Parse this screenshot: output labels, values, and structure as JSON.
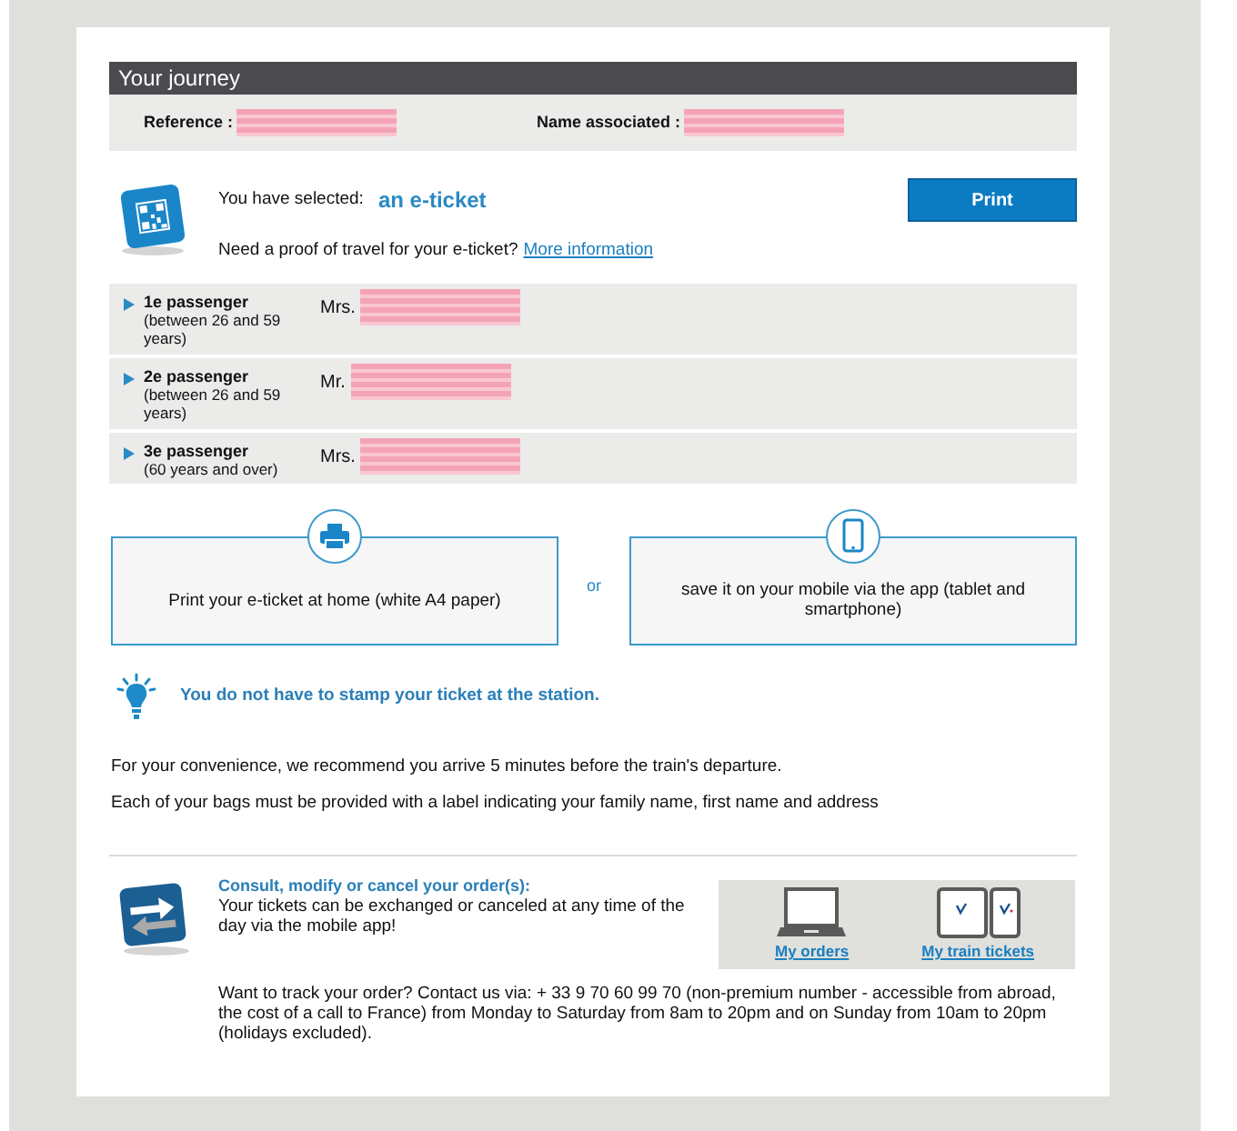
{
  "header": {
    "title": "Your journey"
  },
  "reference_row": [
    {
      "label": "Reference :",
      "redacted": true
    },
    {
      "label": "Name associated :",
      "redacted": true
    }
  ],
  "e_ticket": {
    "intro": "You have selected:",
    "choice": "an e-ticket",
    "print_button": "Print",
    "proof_question": "Need a proof of travel for your e-ticket?",
    "proof_link": "More information"
  },
  "passengers": [
    {
      "label": "1e passenger",
      "age_range": "(between 26 and 59 years)",
      "title": "Mrs.",
      "redacted": true
    },
    {
      "label": "2e passenger",
      "age_range": "(between 26 and 59 years)",
      "title": "Mr.",
      "redacted": true
    },
    {
      "label": "3e passenger",
      "age_range": "(60 years and over)",
      "title": "Mrs.",
      "redacted": true
    }
  ],
  "options": [
    {
      "kind": "printer",
      "text": "Print your e-ticket at home (white A4 paper)"
    },
    {
      "kind": "phone",
      "text": "save it on your mobile via the app (tablet and smartphone)"
    }
  ],
  "options_separator": "or",
  "tip": "You do not have to stamp your ticket at the station.",
  "notes": [
    "For your convenience, we recommend you arrive 5 minutes before the train's departure.",
    "Each of your bags must be provided with a label indicating your family name, first name and address"
  ],
  "order_help": {
    "title": "Consult, modify or cancel your order(s):",
    "text": "Your tickets can be exchanged or canceled at any time of the day via the mobile app!",
    "links": [
      {
        "kind": "laptop",
        "label": "My orders"
      },
      {
        "kind": "devices",
        "label": "My train tickets"
      }
    ],
    "contact": "Want to track your order? Contact us via: + 33 9 70 60 99 70 (non-premium number - accessible from abroad, the cost of a call to France) from Monday to Saturday from 8am to 20pm and on Sunday from 10am to 20pm (holidays excluded)."
  }
}
